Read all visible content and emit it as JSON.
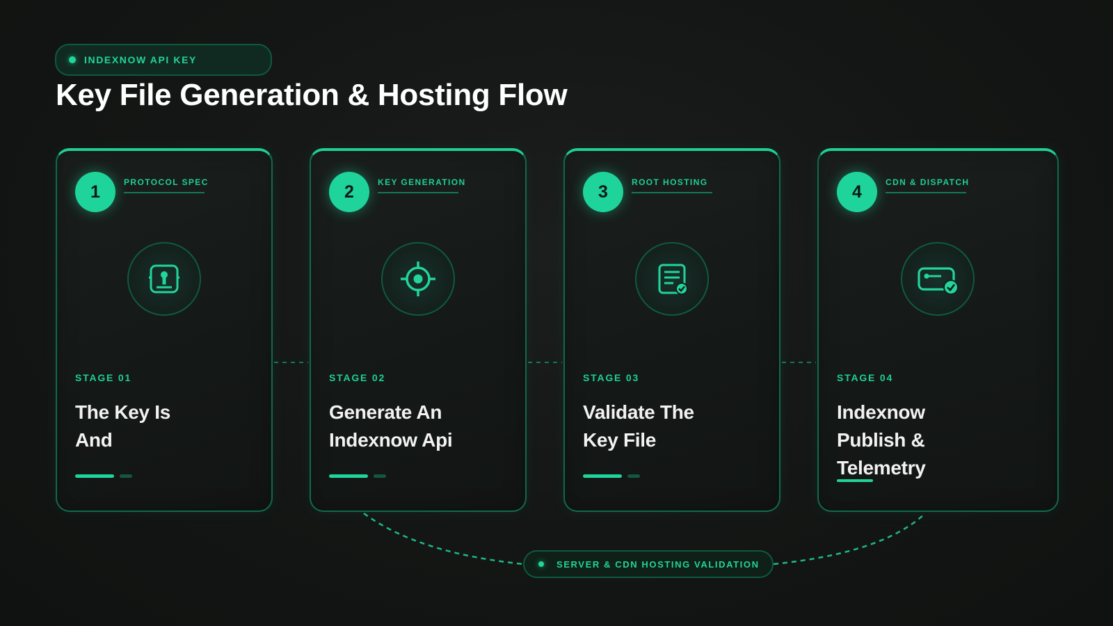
{
  "header": {
    "badge": "INDEXNOW API KEY",
    "title": "Key File Generation & Hosting Flow"
  },
  "colors": {
    "background": "#141615",
    "accent": "#1fd49a",
    "card_border": "#0f6b4d",
    "text": "#f2f2f2"
  },
  "stages": [
    {
      "number": "1",
      "label": "PROTOCOL SPEC",
      "icon": "id-badge-icon",
      "stage": "STAGE 01",
      "title_lines": [
        "The Key Is",
        "And"
      ]
    },
    {
      "number": "2",
      "label": "KEY GENERATION",
      "icon": "target-icon",
      "stage": "STAGE 02",
      "title_lines": [
        "Generate An",
        "Indexnow Api"
      ]
    },
    {
      "number": "3",
      "label": "ROOT HOSTING",
      "icon": "document-check-icon",
      "stage": "STAGE 03",
      "title_lines": [
        "Validate The",
        "Key File"
      ]
    },
    {
      "number": "4",
      "label": "CDN & DISPATCH",
      "icon": "key-card-check-icon",
      "stage": "STAGE 04",
      "title_lines": [
        "Indexnow",
        "Publish &",
        "Telemetry"
      ]
    }
  ],
  "footer": {
    "badge": "SERVER & CDN HOSTING VALIDATION"
  }
}
